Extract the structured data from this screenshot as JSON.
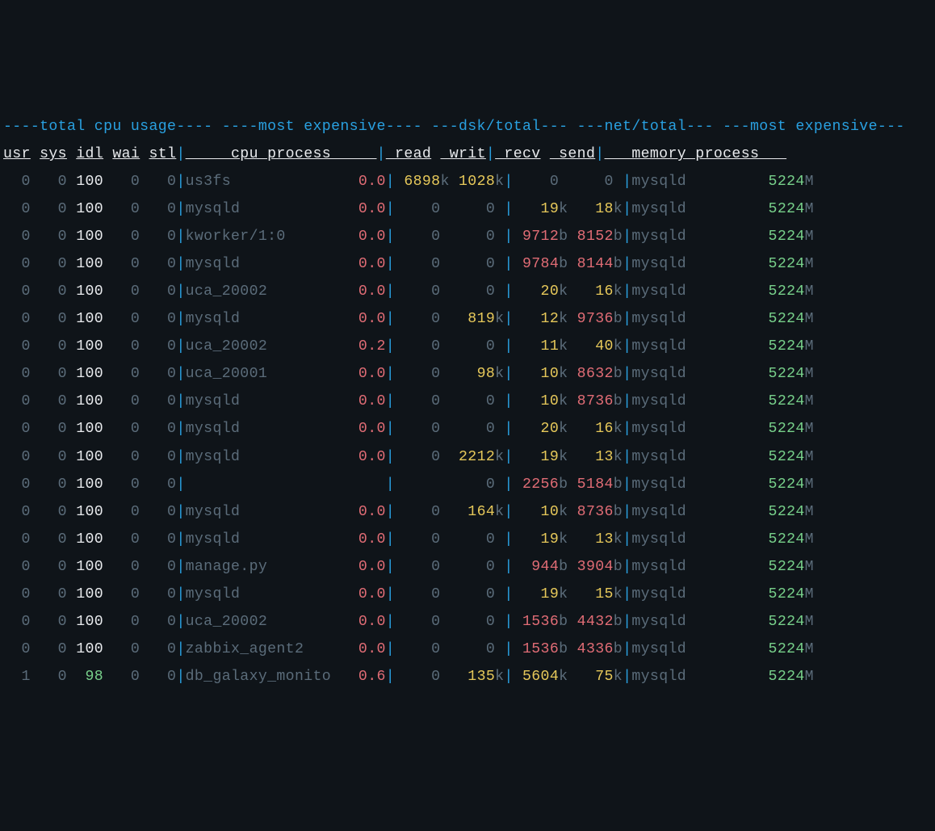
{
  "headers": {
    "group1": "total cpu usage",
    "group2": "most expensive",
    "group3": "dsk/total",
    "group4": "net/total",
    "group5": "most expensive",
    "usr": "usr",
    "sys": "sys",
    "idl": "idl",
    "wai": "wai",
    "stl": "stl",
    "cpu_process": "cpu process",
    "read": "read",
    "writ": "writ",
    "recv": "recv",
    "send": "send",
    "memory_process": "memory process"
  },
  "rows": [
    {
      "usr": "0",
      "sys": "0",
      "idl": "100",
      "idl_c": "white",
      "wai": "0",
      "stl": "0",
      "proc": "us3fs",
      "cpu": "0.0",
      "read": "6898",
      "read_u": "k",
      "read_c": "yellow",
      "writ": "1028",
      "writ_u": "k",
      "writ_c": "yellow",
      "recv": "0",
      "recv_u": "",
      "recv_c": "dim",
      "send": "0",
      "send_u": "",
      "send_c": "dim",
      "mproc": "mysqld",
      "mem": "5224",
      "mem_u": "M"
    },
    {
      "usr": "0",
      "sys": "0",
      "idl": "100",
      "idl_c": "white",
      "wai": "0",
      "stl": "0",
      "proc": "mysqld",
      "cpu": "0.0",
      "read": "0",
      "read_u": "",
      "read_c": "dim",
      "writ": "0",
      "writ_u": "",
      "writ_c": "dim",
      "recv": "19",
      "recv_u": "k",
      "recv_c": "yellow",
      "send": "18",
      "send_u": "k",
      "send_c": "yellow",
      "mproc": "mysqld",
      "mem": "5224",
      "mem_u": "M"
    },
    {
      "usr": "0",
      "sys": "0",
      "idl": "100",
      "idl_c": "white",
      "wai": "0",
      "stl": "0",
      "proc": "kworker/1:0",
      "cpu": "0.0",
      "read": "0",
      "read_u": "",
      "read_c": "dim",
      "writ": "0",
      "writ_u": "",
      "writ_c": "dim",
      "recv": "9712",
      "recv_u": "b",
      "recv_c": "red",
      "send": "8152",
      "send_u": "b",
      "send_c": "red",
      "mproc": "mysqld",
      "mem": "5224",
      "mem_u": "M"
    },
    {
      "usr": "0",
      "sys": "0",
      "idl": "100",
      "idl_c": "white",
      "wai": "0",
      "stl": "0",
      "proc": "mysqld",
      "cpu": "0.0",
      "read": "0",
      "read_u": "",
      "read_c": "dim",
      "writ": "0",
      "writ_u": "",
      "writ_c": "dim",
      "recv": "9784",
      "recv_u": "b",
      "recv_c": "red",
      "send": "8144",
      "send_u": "b",
      "send_c": "red",
      "mproc": "mysqld",
      "mem": "5224",
      "mem_u": "M"
    },
    {
      "usr": "0",
      "sys": "0",
      "idl": "100",
      "idl_c": "white",
      "wai": "0",
      "stl": "0",
      "proc": "uca_20002",
      "cpu": "0.0",
      "read": "0",
      "read_u": "",
      "read_c": "dim",
      "writ": "0",
      "writ_u": "",
      "writ_c": "dim",
      "recv": "20",
      "recv_u": "k",
      "recv_c": "yellow",
      "send": "16",
      "send_u": "k",
      "send_c": "yellow",
      "mproc": "mysqld",
      "mem": "5224",
      "mem_u": "M"
    },
    {
      "usr": "0",
      "sys": "0",
      "idl": "100",
      "idl_c": "white",
      "wai": "0",
      "stl": "0",
      "proc": "mysqld",
      "cpu": "0.0",
      "read": "0",
      "read_u": "",
      "read_c": "dim",
      "writ": "819",
      "writ_u": "k",
      "writ_c": "yellow",
      "recv": "12",
      "recv_u": "k",
      "recv_c": "yellow",
      "send": "9736",
      "send_u": "b",
      "send_c": "red",
      "mproc": "mysqld",
      "mem": "5224",
      "mem_u": "M"
    },
    {
      "usr": "0",
      "sys": "0",
      "idl": "100",
      "idl_c": "white",
      "wai": "0",
      "stl": "0",
      "proc": "uca_20002",
      "cpu": "0.2",
      "read": "0",
      "read_u": "",
      "read_c": "dim",
      "writ": "0",
      "writ_u": "",
      "writ_c": "dim",
      "recv": "11",
      "recv_u": "k",
      "recv_c": "yellow",
      "send": "40",
      "send_u": "k",
      "send_c": "yellow",
      "mproc": "mysqld",
      "mem": "5224",
      "mem_u": "M"
    },
    {
      "usr": "0",
      "sys": "0",
      "idl": "100",
      "idl_c": "white",
      "wai": "0",
      "stl": "0",
      "proc": "uca_20001",
      "cpu": "0.0",
      "read": "0",
      "read_u": "",
      "read_c": "dim",
      "writ": "98",
      "writ_u": "k",
      "writ_c": "yellow",
      "recv": "10",
      "recv_u": "k",
      "recv_c": "yellow",
      "send": "8632",
      "send_u": "b",
      "send_c": "red",
      "mproc": "mysqld",
      "mem": "5224",
      "mem_u": "M"
    },
    {
      "usr": "0",
      "sys": "0",
      "idl": "100",
      "idl_c": "white",
      "wai": "0",
      "stl": "0",
      "proc": "mysqld",
      "cpu": "0.0",
      "read": "0",
      "read_u": "",
      "read_c": "dim",
      "writ": "0",
      "writ_u": "",
      "writ_c": "dim",
      "recv": "10",
      "recv_u": "k",
      "recv_c": "yellow",
      "send": "8736",
      "send_u": "b",
      "send_c": "red",
      "mproc": "mysqld",
      "mem": "5224",
      "mem_u": "M"
    },
    {
      "usr": "0",
      "sys": "0",
      "idl": "100",
      "idl_c": "white",
      "wai": "0",
      "stl": "0",
      "proc": "mysqld",
      "cpu": "0.0",
      "read": "0",
      "read_u": "",
      "read_c": "dim",
      "writ": "0",
      "writ_u": "",
      "writ_c": "dim",
      "recv": "20",
      "recv_u": "k",
      "recv_c": "yellow",
      "send": "16",
      "send_u": "k",
      "send_c": "yellow",
      "mproc": "mysqld",
      "mem": "5224",
      "mem_u": "M"
    },
    {
      "usr": "0",
      "sys": "0",
      "idl": "100",
      "idl_c": "white",
      "wai": "0",
      "stl": "0",
      "proc": "mysqld",
      "cpu": "0.0",
      "read": "0",
      "read_u": "",
      "read_c": "dim",
      "writ": "2212",
      "writ_u": "k",
      "writ_c": "yellow",
      "recv": "19",
      "recv_u": "k",
      "recv_c": "yellow",
      "send": "13",
      "send_u": "k",
      "send_c": "yellow",
      "mproc": "mysqld",
      "mem": "5224",
      "mem_u": "M"
    },
    {
      "usr": "0",
      "sys": "0",
      "idl": "100",
      "idl_c": "white",
      "wai": "0",
      "stl": "0",
      "proc": "",
      "cpu": "",
      "read": "",
      "read_u": "",
      "read_c": "dim",
      "writ": "0",
      "writ_u": "",
      "writ_c": "dim",
      "recv": "2256",
      "recv_u": "b",
      "recv_c": "red",
      "send": "5184",
      "send_u": "b",
      "send_c": "red",
      "mproc": "mysqld",
      "mem": "5224",
      "mem_u": "M"
    },
    {
      "usr": "0",
      "sys": "0",
      "idl": "100",
      "idl_c": "white",
      "wai": "0",
      "stl": "0",
      "proc": "mysqld",
      "cpu": "0.0",
      "read": "0",
      "read_u": "",
      "read_c": "dim",
      "writ": "164",
      "writ_u": "k",
      "writ_c": "yellow",
      "recv": "10",
      "recv_u": "k",
      "recv_c": "yellow",
      "send": "8736",
      "send_u": "b",
      "send_c": "red",
      "mproc": "mysqld",
      "mem": "5224",
      "mem_u": "M"
    },
    {
      "usr": "0",
      "sys": "0",
      "idl": "100",
      "idl_c": "white",
      "wai": "0",
      "stl": "0",
      "proc": "mysqld",
      "cpu": "0.0",
      "read": "0",
      "read_u": "",
      "read_c": "dim",
      "writ": "0",
      "writ_u": "",
      "writ_c": "dim",
      "recv": "19",
      "recv_u": "k",
      "recv_c": "yellow",
      "send": "13",
      "send_u": "k",
      "send_c": "yellow",
      "mproc": "mysqld",
      "mem": "5224",
      "mem_u": "M"
    },
    {
      "usr": "0",
      "sys": "0",
      "idl": "100",
      "idl_c": "white",
      "wai": "0",
      "stl": "0",
      "proc": "manage.py",
      "cpu": "0.0",
      "read": "0",
      "read_u": "",
      "read_c": "dim",
      "writ": "0",
      "writ_u": "",
      "writ_c": "dim",
      "recv": "944",
      "recv_u": "b",
      "recv_c": "red",
      "send": "3904",
      "send_u": "b",
      "send_c": "red",
      "mproc": "mysqld",
      "mem": "5224",
      "mem_u": "M"
    },
    {
      "usr": "0",
      "sys": "0",
      "idl": "100",
      "idl_c": "white",
      "wai": "0",
      "stl": "0",
      "proc": "mysqld",
      "cpu": "0.0",
      "read": "0",
      "read_u": "",
      "read_c": "dim",
      "writ": "0",
      "writ_u": "",
      "writ_c": "dim",
      "recv": "19",
      "recv_u": "k",
      "recv_c": "yellow",
      "send": "15",
      "send_u": "k",
      "send_c": "yellow",
      "mproc": "mysqld",
      "mem": "5224",
      "mem_u": "M"
    },
    {
      "usr": "0",
      "sys": "0",
      "idl": "100",
      "idl_c": "white",
      "wai": "0",
      "stl": "0",
      "proc": "uca_20002",
      "cpu": "0.0",
      "read": "0",
      "read_u": "",
      "read_c": "dim",
      "writ": "0",
      "writ_u": "",
      "writ_c": "dim",
      "recv": "1536",
      "recv_u": "b",
      "recv_c": "red",
      "send": "4432",
      "send_u": "b",
      "send_c": "red",
      "mproc": "mysqld",
      "mem": "5224",
      "mem_u": "M"
    },
    {
      "usr": "0",
      "sys": "0",
      "idl": "100",
      "idl_c": "white",
      "wai": "0",
      "stl": "0",
      "proc": "zabbix_agent2",
      "cpu": "0.0",
      "read": "0",
      "read_u": "",
      "read_c": "dim",
      "writ": "0",
      "writ_u": "",
      "writ_c": "dim",
      "recv": "1536",
      "recv_u": "b",
      "recv_c": "red",
      "send": "4336",
      "send_u": "b",
      "send_c": "red",
      "mproc": "mysqld",
      "mem": "5224",
      "mem_u": "M"
    },
    {
      "usr": "1",
      "sys": "0",
      "idl": "98",
      "idl_c": "green",
      "wai": "0",
      "stl": "0",
      "proc": "db_galaxy_monito",
      "cpu": "0.6",
      "read": "0",
      "read_u": "",
      "read_c": "dim",
      "writ": "135",
      "writ_u": "k",
      "writ_c": "yellow",
      "recv": "5604",
      "recv_u": "k",
      "recv_c": "yellow",
      "send": "75",
      "send_u": "k",
      "send_c": "yellow",
      "mproc": "mysqld",
      "mem": "5224",
      "mem_u": "M"
    }
  ]
}
